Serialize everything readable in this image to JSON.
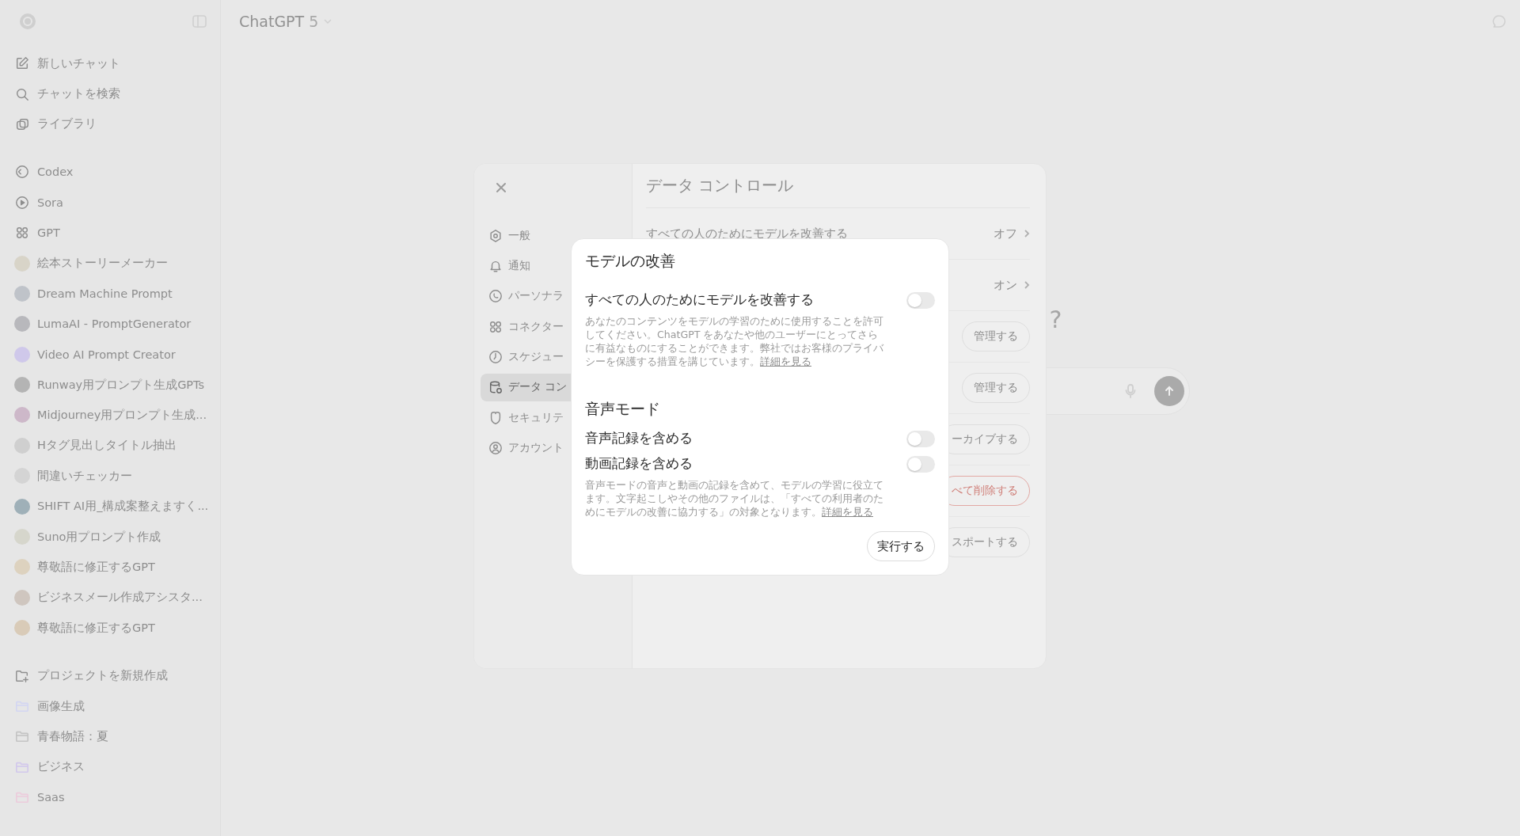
{
  "sidebar": {
    "nav": [
      {
        "label": "新しいチャット"
      },
      {
        "label": "チャットを検索"
      },
      {
        "label": "ライブラリ"
      }
    ],
    "apps": [
      {
        "label": "Codex"
      },
      {
        "label": "Sora"
      },
      {
        "label": "GPT"
      }
    ],
    "gpts": [
      {
        "label": "絵本ストーリーメーカー"
      },
      {
        "label": "Dream Machine Prompt"
      },
      {
        "label": "LumaAI - PromptGenerator"
      },
      {
        "label": "Video AI Prompt Creator"
      },
      {
        "label": "Runway用プロンプト生成GPTs"
      },
      {
        "label": "Midjourney用プロンプト生成..."
      },
      {
        "label": "Hタグ見出しタイトル抽出"
      },
      {
        "label": "間違いチェッカー"
      },
      {
        "label": "SHIFT AI用_構成案整えますく..."
      },
      {
        "label": "Suno用プロンプト作成"
      },
      {
        "label": "尊敬語に修正するGPT"
      },
      {
        "label": "ビジネスメール作成アシスタ..."
      },
      {
        "label": "尊敬語に修正するGPT"
      }
    ],
    "projects": [
      {
        "label": "プロジェクトを新規作成",
        "kind": "new"
      },
      {
        "label": "画像生成",
        "kind": "folder",
        "color": "#d3d6f2"
      },
      {
        "label": "青春物語：夏",
        "kind": "folder",
        "color": "#c4c4c4"
      },
      {
        "label": "ビジネス",
        "kind": "folder",
        "color": "#d2c8ec"
      },
      {
        "label": "Saas",
        "kind": "folder",
        "color": "#ecccdc"
      }
    ]
  },
  "header": {
    "title": "ChatGPT",
    "version": "5"
  },
  "main": {
    "greeting_end": "?"
  },
  "settings": {
    "nav": [
      {
        "label": "一般",
        "selected": false
      },
      {
        "label": "通知",
        "selected": false
      },
      {
        "label": "パーソナラ",
        "selected": false
      },
      {
        "label": "コネクター",
        "selected": false
      },
      {
        "label": "スケジュー",
        "selected": false
      },
      {
        "label": "データ コン",
        "selected": true
      },
      {
        "label": "セキュリテ",
        "selected": false
      },
      {
        "label": "アカウント",
        "selected": false
      }
    ],
    "title": "データ コントロール",
    "rows": [
      {
        "kind": "link",
        "label": "すべての人のためにモデルを改善する",
        "value": "オフ"
      },
      {
        "kind": "link",
        "value": "オン"
      },
      {
        "kind": "button",
        "action": "管理する"
      },
      {
        "kind": "button",
        "action": "管理する"
      },
      {
        "kind": "button",
        "action": "ーカイブする"
      },
      {
        "kind": "danger",
        "action": "べて削除する"
      },
      {
        "kind": "button",
        "action": "スポートする"
      }
    ]
  },
  "model_dialog": {
    "title": "モデルの改善",
    "rows": [
      {
        "kind": "toggle",
        "label": "すべての人のためにモデルを改善する",
        "checked": false
      },
      {
        "kind": "description",
        "text": "あなたのコンテンツをモデルの学習のために使用することを許可してください。ChatGPT をあなたや他のユーザーにとってさらに有益なものにすることができます。弊社ではお客様のプライバシーを保護する措置を講じています。",
        "link": "詳細を見る"
      },
      {
        "kind": "heading",
        "text": "音声モード"
      },
      {
        "kind": "toggle",
        "label": "音声記録を含める",
        "checked": false
      },
      {
        "kind": "toggle",
        "label": "動画記録を含める",
        "checked": false
      },
      {
        "kind": "description",
        "text": "音声モードの音声と動画の記録を含めて、モデルの学習に役立てます。文字起こしやその他のファイルは、「すべての利用者のためにモデルの改善に協力する」の対象となります。",
        "link": "詳細を見る"
      }
    ],
    "button": "実行する"
  }
}
